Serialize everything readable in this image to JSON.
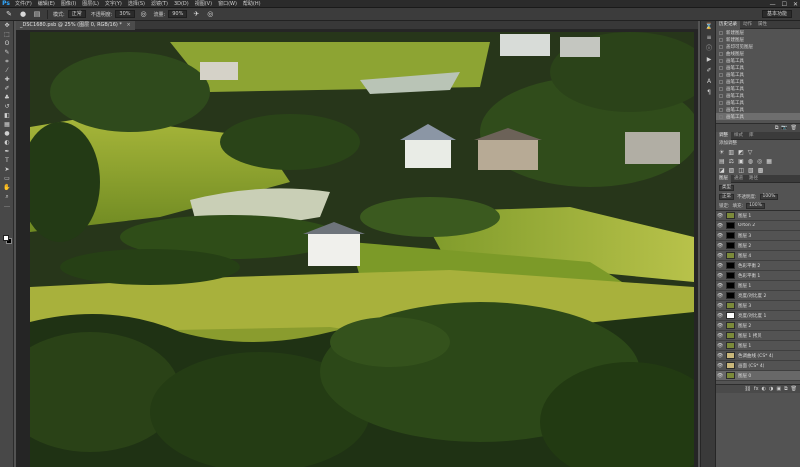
{
  "app": {
    "logo": "Ps"
  },
  "menu": [
    {
      "label": "文件(F)"
    },
    {
      "label": "编辑(E)"
    },
    {
      "label": "图像(I)"
    },
    {
      "label": "图层(L)"
    },
    {
      "label": "文字(Y)"
    },
    {
      "label": "选择(S)"
    },
    {
      "label": "滤镜(T)"
    },
    {
      "label": "3D(D)"
    },
    {
      "label": "视图(V)"
    },
    {
      "label": "窗口(W)"
    },
    {
      "label": "帮助(H)"
    }
  ],
  "window_controls": {
    "minimize": "—",
    "maximize": "☐",
    "close": "✕"
  },
  "options_bar": {
    "mode_label": "模式:",
    "mode_value": "正常",
    "opacity_label": "不透明度:",
    "opacity_value": "30%",
    "flow_label": "流量:",
    "flow_value": "90%",
    "workspace": "基本功能"
  },
  "document_tab": {
    "title": "_DSC1680.psb @ 25% (图层 0, RGB/16) *",
    "close": "×"
  },
  "tools": [
    {
      "name": "move-tool-icon",
      "glyph": "✥"
    },
    {
      "name": "marquee-tool-icon",
      "glyph": "⬚"
    },
    {
      "name": "lasso-tool-icon",
      "glyph": "ʘ"
    },
    {
      "name": "quick-select-tool-icon",
      "glyph": "✎"
    },
    {
      "name": "crop-tool-icon",
      "glyph": "⌗"
    },
    {
      "name": "eyedropper-tool-icon",
      "glyph": "⁄"
    },
    {
      "name": "healing-brush-tool-icon",
      "glyph": "✚"
    },
    {
      "name": "brush-tool-icon",
      "glyph": "✐"
    },
    {
      "name": "clone-stamp-tool-icon",
      "glyph": "♣"
    },
    {
      "name": "history-brush-tool-icon",
      "glyph": "↺"
    },
    {
      "name": "eraser-tool-icon",
      "glyph": "◧"
    },
    {
      "name": "gradient-tool-icon",
      "glyph": "▦"
    },
    {
      "name": "blur-tool-icon",
      "glyph": "●"
    },
    {
      "name": "dodge-tool-icon",
      "glyph": "◐"
    },
    {
      "name": "pen-tool-icon",
      "glyph": "✒"
    },
    {
      "name": "type-tool-icon",
      "glyph": "T"
    },
    {
      "name": "path-select-tool-icon",
      "glyph": "➤"
    },
    {
      "name": "shape-tool-icon",
      "glyph": "▭"
    },
    {
      "name": "hand-tool-icon",
      "glyph": "✋"
    },
    {
      "name": "zoom-tool-icon",
      "glyph": "⌕"
    },
    {
      "name": "edit-toolbar-icon",
      "glyph": "…"
    }
  ],
  "swatches": {
    "foreground": "#ffffff",
    "background": "#000000"
  },
  "panel_strip": [
    {
      "name": "history-panel-icon",
      "glyph": "⌛"
    },
    {
      "name": "properties-panel-icon",
      "glyph": "≡"
    },
    {
      "name": "info-panel-icon",
      "glyph": "ⓘ"
    },
    {
      "name": "actions-panel-icon",
      "glyph": "▶"
    },
    {
      "name": "brush-panel-icon",
      "glyph": "✐"
    },
    {
      "name": "character-panel-icon",
      "glyph": "A"
    },
    {
      "name": "paragraph-panel-icon",
      "glyph": "¶"
    }
  ],
  "history_panel": {
    "tabs": [
      {
        "label": "历史记录",
        "active": true
      },
      {
        "label": "动作",
        "active": false
      },
      {
        "label": "属性",
        "active": false
      }
    ],
    "items": [
      {
        "label": "新建图层",
        "selected": false
      },
      {
        "label": "新建图层",
        "selected": false
      },
      {
        "label": "盖印可见图层",
        "selected": false
      },
      {
        "label": "曲线图层",
        "selected": false
      },
      {
        "label": "画笔工具",
        "selected": false
      },
      {
        "label": "画笔工具",
        "selected": false
      },
      {
        "label": "画笔工具",
        "selected": false
      },
      {
        "label": "画笔工具",
        "selected": false
      },
      {
        "label": "画笔工具",
        "selected": false
      },
      {
        "label": "画笔工具",
        "selected": false
      },
      {
        "label": "画笔工具",
        "selected": false
      },
      {
        "label": "画笔工具",
        "selected": false
      },
      {
        "label": "画笔工具",
        "selected": true
      }
    ],
    "footer_icons": [
      "⧉",
      "📷",
      "🗑"
    ]
  },
  "adjustments_panel": {
    "tabs": [
      {
        "label": "调整",
        "active": true
      },
      {
        "label": "样式",
        "active": false
      },
      {
        "label": "库",
        "active": false
      }
    ],
    "title": "添加调整",
    "row1": [
      "☀",
      "▥",
      "◩",
      "▽"
    ],
    "row2": [
      "▤",
      "⚖",
      "▣",
      "◍",
      "◎",
      "▦"
    ],
    "row3": [
      "◪",
      "▨",
      "◫",
      "▧",
      "▩"
    ]
  },
  "layers_panel": {
    "tabs": [
      {
        "label": "图层",
        "active": true
      },
      {
        "label": "通道",
        "active": false
      },
      {
        "label": "路径",
        "active": false
      }
    ],
    "kind_label": "类型",
    "blend_mode": "正常",
    "opacity_label": "不透明度:",
    "opacity_value": "100%",
    "lock_label": "锁定:",
    "fill_label": "填充:",
    "fill_value": "100%",
    "layers": [
      {
        "name": "图层 1",
        "thumb": "photo",
        "selected": false
      },
      {
        "name": "Orton 2",
        "thumb": "mask",
        "selected": false
      },
      {
        "name": "图层 3",
        "thumb": "mask",
        "selected": false
      },
      {
        "name": "图层 2",
        "thumb": "mask",
        "selected": false
      },
      {
        "name": "图层 4",
        "thumb": "photo",
        "selected": false
      },
      {
        "name": "色彩平衡 2",
        "thumb": "mask",
        "selected": false
      },
      {
        "name": "色彩平衡 1",
        "thumb": "mask",
        "selected": false
      },
      {
        "name": "图层 1",
        "thumb": "mask",
        "selected": false
      },
      {
        "name": "亮度/对比度 2",
        "thumb": "mask",
        "selected": false
      },
      {
        "name": "图层 3",
        "thumb": "photo",
        "selected": false
      },
      {
        "name": "亮度/对比度 1",
        "thumb": "white",
        "selected": false
      },
      {
        "name": "图层 2",
        "thumb": "photo",
        "selected": false
      },
      {
        "name": "图层 1 拷贝",
        "thumb": "photo",
        "selected": false
      },
      {
        "name": "图层 1",
        "thumb": "photo",
        "selected": false
      },
      {
        "name": "色调曲线 (CS* 4)",
        "thumb": "folder",
        "selected": false
      },
      {
        "name": "画面 (CS* 4)",
        "thumb": "folder",
        "selected": false
      },
      {
        "name": "图层 0",
        "thumb": "photo",
        "selected": true
      }
    ],
    "footer_icons": [
      "⛓",
      "fx",
      "◐",
      "◑",
      "▣",
      "⧉",
      "🗑"
    ]
  }
}
